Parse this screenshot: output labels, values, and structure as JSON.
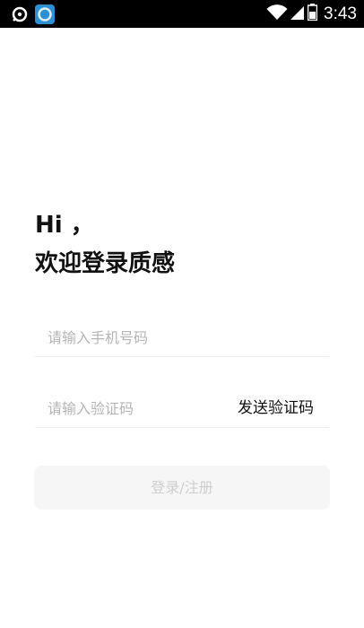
{
  "status_bar": {
    "time": "3:43",
    "icons": [
      "message-icon",
      "app-icon",
      "wifi-icon",
      "signal-icon",
      "battery-icon"
    ]
  },
  "greeting": {
    "line1": "Hi ，",
    "line2": "欢迎登录质感"
  },
  "login_form": {
    "phone_placeholder": "请输入手机号码",
    "code_placeholder": "请输入验证码",
    "send_code_label": "发送验证码",
    "submit_label": "登录/注册"
  },
  "colors": {
    "status_bar_bg": "#000000",
    "title_text": "#111111",
    "placeholder_text": "#b5b5b5",
    "button_bg": "#f6f6f6",
    "button_text": "#cfcfcf",
    "divider": "#eeeeee"
  }
}
